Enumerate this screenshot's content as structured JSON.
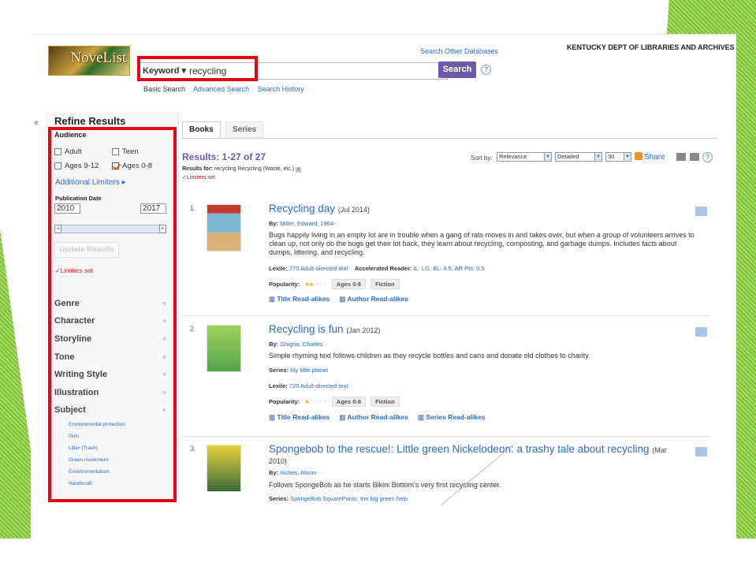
{
  "header": {
    "logo_text": "NoveList",
    "search_other": "Search Other Databases",
    "library": "KENTUCKY DEPT OF LIBRARIES AND ARCHIVES",
    "field_select": "Keyword ▾",
    "query": "recycling",
    "search_button": "Search",
    "nav": [
      "Basic Search",
      "Advanced Search",
      "Search History"
    ]
  },
  "sidebar": {
    "title": "Refine Results",
    "audience_label": "Audience",
    "audience": [
      {
        "label": "Adult",
        "checked": false
      },
      {
        "label": "Teen",
        "checked": false
      },
      {
        "label": "Ages 9-12",
        "checked": false
      },
      {
        "label": "Ages 0-8",
        "checked": true
      }
    ],
    "additional_limiters": "Additional Limiters ▸",
    "pub_date_label": "Publication Date",
    "year_from": "2010",
    "year_to": "2017",
    "update_button": "Update Results",
    "limiters_set": "✓Limiters set",
    "facets": [
      "Genre",
      "Character",
      "Storyline",
      "Tone",
      "Writing Style",
      "Illustration",
      "Subject"
    ],
    "subjects": [
      "Environmental protection",
      "Girls",
      "Litter (Trash)",
      "Green movement",
      "Environmentalism",
      "Handicraft"
    ]
  },
  "main": {
    "tabs": [
      "Books",
      "Series"
    ],
    "results_count": "Results: 1-27 of 27",
    "results_for_label": "Results for:",
    "results_for_terms": "recycling  Recycling (Waste, etc.)",
    "limiters_set": "✓Limiters set",
    "sort_by_label": "Sort by:",
    "sort_value": "Relevance",
    "view_value": "Detailed",
    "per_page": "30",
    "share": "Share",
    "results": [
      {
        "num": "1.",
        "title": "Recycling day",
        "date": "(Jul 2014)",
        "by_label": "By:",
        "author": "Miller, Edward, 1964-",
        "description": "Bugs happily living in an empty lot are in trouble when a gang of rats moves in and takes over, but when a group of volunteers arrives to clean up, not only do the bugs get their lot back, they learn about recycling, composting, and garbage dumps. Includes facts about dumps, littering, and recycling.",
        "lexile_label": "Lexile:",
        "lexile": "770 Adult-directed text",
        "ar_label": "Accelerated Reader:",
        "ar": "IL: LG, BL: 4.5, AR Pts: 0.5",
        "popularity_label": "Popularity:",
        "stars": 2,
        "audience_tag": "Ages 0-8",
        "genre_tag": "Fiction",
        "readalikes": [
          "Title Read-alikes",
          "Author Read-alikes"
        ]
      },
      {
        "num": "2.",
        "title": "Recycling is fun",
        "date": "(Jan 2012)",
        "by_label": "By:",
        "author": "Ghigna, Charles",
        "description": "Simple rhyming text follows children as they recycle bottles and cans and donate old clothes to charity.",
        "series_label": "Series:",
        "series": "My little planet",
        "lexile_label": "Lexile:",
        "lexile": "720 Adult-directed text",
        "popularity_label": "Popularity:",
        "stars": 1,
        "audience_tag": "Ages 0-8",
        "genre_tag": "Fiction",
        "readalikes": [
          "Title Read-alikes",
          "Author Read-alikes",
          "Series Read-alikes"
        ]
      },
      {
        "num": "3.",
        "title": "Spongebob to the rescue!: Little green Nickelodeon: a trashy tale about recycling",
        "date": "(Mar",
        "date2": "2010)",
        "by_label": "By:",
        "author": "Inches, Alison",
        "description": "Follows SpongeBob as he starts Bikini Bottom's very first recycling center.",
        "series_label": "Series:",
        "series": "SpongeBob SquarePants: the big green help"
      }
    ]
  },
  "colors": {
    "highlight": "#e30613",
    "accent": "#6c5aa8",
    "link": "#2a6bc9"
  }
}
